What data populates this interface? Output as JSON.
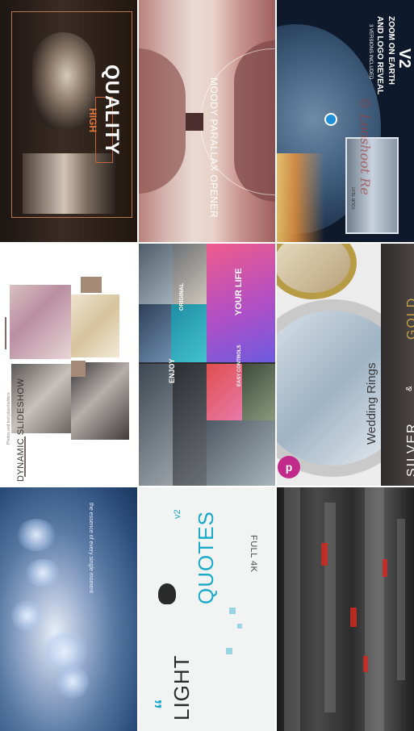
{
  "grid": {
    "tiles": [
      {
        "id": "high-quality",
        "texts": {
          "quality": "QUALITY",
          "high": "HIGH"
        }
      },
      {
        "id": "moody-parallax",
        "texts": {
          "title": "MOODY PARALLAX OPENER"
        }
      },
      {
        "id": "zoom-earth",
        "texts": {
          "line1": "ZOOM ON EARTH",
          "line2": "AND LOGO REVEAL",
          "version": "V2",
          "note": "3 VERSIONS INCLUDED",
          "placeholder": "YOUR TEXT",
          "watermark": "© Looshoot Re"
        }
      },
      {
        "id": "dynamic-slideshow",
        "texts": {
          "title": "DYNAMIC SLIDESHOW",
          "sub": "Photos and text placeholders"
        }
      },
      {
        "id": "enjoy-collage",
        "texts": {
          "enjoy": "ENJOY",
          "original": "ORIGINAL",
          "easy": "EASY CONTROLS",
          "life": "YOUR LIFE"
        }
      },
      {
        "id": "wedding-rings",
        "texts": {
          "silver": "SILVER",
          "amp": "&",
          "gold": "GOLD",
          "title": "Wedding Rings",
          "badge": "p"
        }
      },
      {
        "id": "birds",
        "texts": {
          "caption": "the essence of every single moment"
        }
      },
      {
        "id": "light-quotes",
        "texts": {
          "light": "LIGHT",
          "quotes": "QUOTES",
          "version": "v2",
          "resolution": "FULL 4K",
          "mark": "“"
        }
      },
      {
        "id": "glitch",
        "texts": {}
      }
    ]
  }
}
